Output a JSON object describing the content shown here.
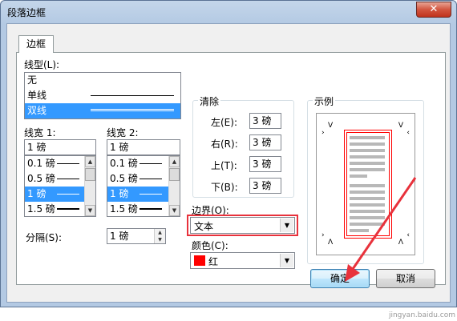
{
  "window": {
    "title": "段落边框",
    "close": "✕"
  },
  "tab": {
    "label": "边框"
  },
  "line_type": {
    "label": "线型(L):",
    "items": [
      {
        "label": "无",
        "style": "none",
        "selected": false
      },
      {
        "label": "单线",
        "style": "single",
        "selected": false
      },
      {
        "label": "双线",
        "style": "double",
        "selected": true
      }
    ]
  },
  "width1": {
    "label": "线宽 1:",
    "value": "1 磅",
    "items": [
      {
        "label": "0.1 磅",
        "weight": 1,
        "selected": false
      },
      {
        "label": "0.5 磅",
        "weight": 1,
        "selected": false
      },
      {
        "label": "1 磅",
        "weight": 1,
        "selected": true
      },
      {
        "label": "1.5 磅",
        "weight": 2,
        "selected": false
      }
    ]
  },
  "width2": {
    "label": "线宽 2:",
    "value": "1 磅",
    "items": [
      {
        "label": "0.1 磅",
        "weight": 1,
        "selected": false
      },
      {
        "label": "0.5 磅",
        "weight": 1,
        "selected": false
      },
      {
        "label": "1 磅",
        "weight": 1,
        "selected": true
      },
      {
        "label": "1.5 磅",
        "weight": 2,
        "selected": false
      }
    ]
  },
  "spacing": {
    "label": "分隔(S):",
    "value": "1 磅"
  },
  "clear": {
    "title": "清除",
    "left": {
      "label": "左(E):",
      "value": "3 磅"
    },
    "right": {
      "label": "右(R):",
      "value": "3 磅"
    },
    "top": {
      "label": "上(T):",
      "value": "3 磅"
    },
    "bottom": {
      "label": "下(B):",
      "value": "3 磅"
    }
  },
  "boundary": {
    "label": "边界(O):",
    "value": "文本"
  },
  "color": {
    "label": "颜色(C):",
    "value": "红",
    "swatch": "#ff0000"
  },
  "preview": {
    "title": "示例"
  },
  "buttons": {
    "ok": "确定",
    "cancel": "取消"
  },
  "watermark": "jingyan.baidu.com",
  "accent": "#e8323c",
  "selection": "#3399ff"
}
